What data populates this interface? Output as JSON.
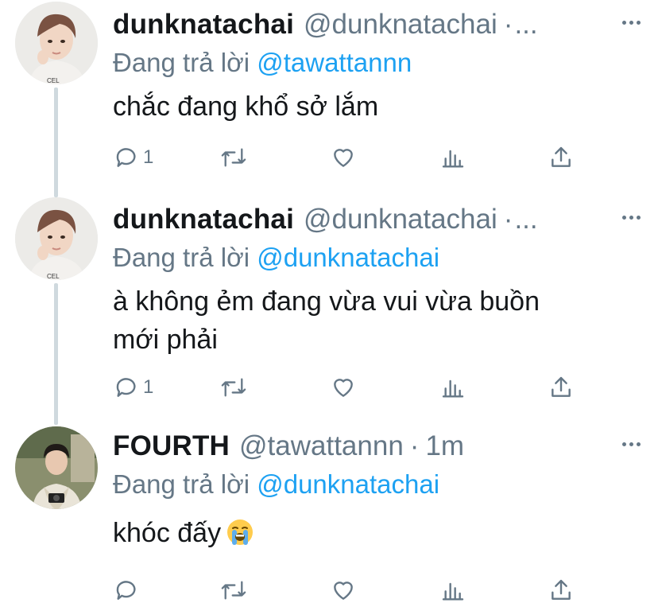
{
  "tweets": [
    {
      "name": "dunknatachai",
      "handle": "@dunknatachai",
      "separator": "·",
      "time": "",
      "ellipsis": "...",
      "replying_prefix": "Đang trả lời",
      "replying_to": "@tawattannn",
      "text_lines": [
        "chắc đang khổ sở lắm"
      ],
      "reply_count": "1"
    },
    {
      "name": "dunknatachai",
      "handle": "@dunknatachai",
      "separator": "·",
      "time": "",
      "ellipsis": "...",
      "replying_prefix": "Đang trả lời",
      "replying_to": "@dunknatachai",
      "text_lines": [
        "à không ẻm đang vừa vui vừa buồn",
        "mới phải"
      ],
      "reply_count": "1"
    },
    {
      "name": "FOURTH",
      "handle": "@tawattannn",
      "separator": "·",
      "time": "1m",
      "ellipsis": "",
      "replying_prefix": "Đang trả lời",
      "replying_to": "@dunknatachai",
      "text_lines": [
        "khóc đấy"
      ],
      "emoji": "loudly-crying-face",
      "reply_count": ""
    }
  ],
  "icons": {
    "reply": "reply-icon",
    "retweet": "retweet-icon",
    "like": "like-icon",
    "analytics": "analytics-icon",
    "share": "share-icon",
    "more": "more-icon"
  },
  "colors": {
    "link": "#1da1f2",
    "secondary": "#657786",
    "thread_line": "#cfd9de"
  }
}
